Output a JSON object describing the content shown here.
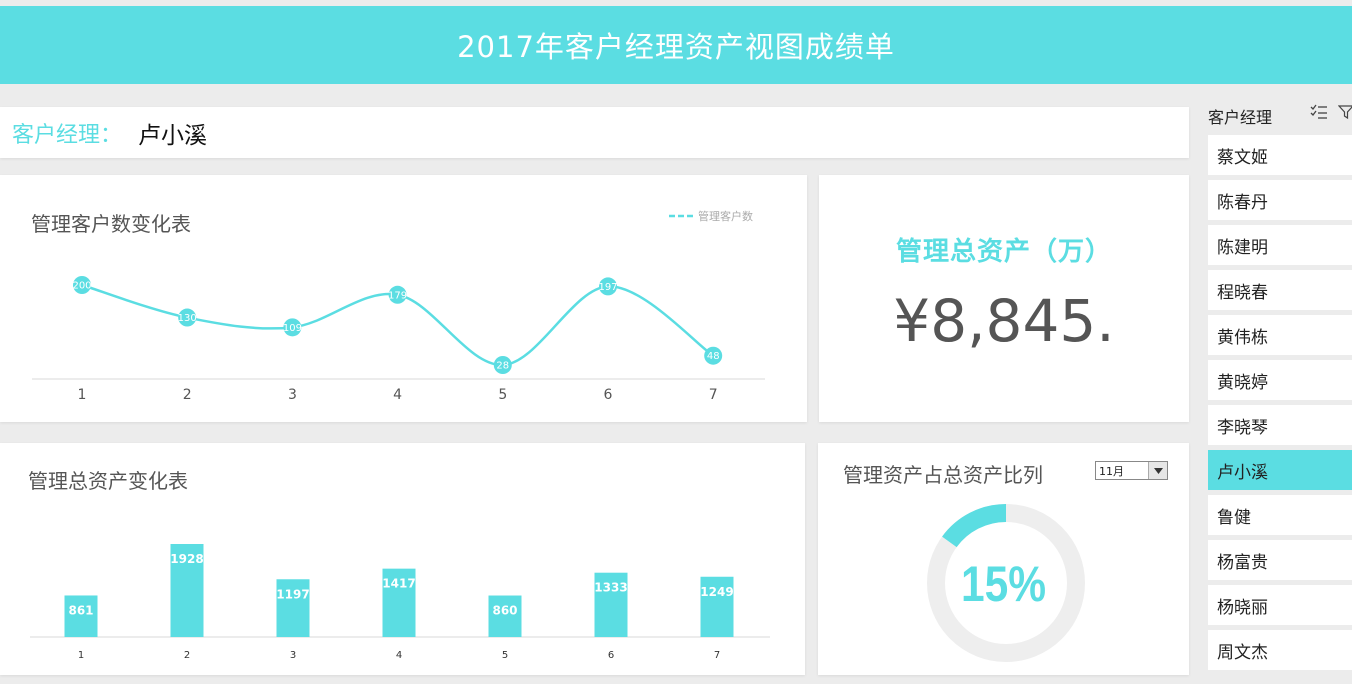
{
  "header": {
    "title": "2017年客户经理资产视图成绩单"
  },
  "manager": {
    "label": "客户经理：",
    "name": "卢小溪"
  },
  "customer_chart": {
    "title": "管理客户数变化表",
    "legend": "管理客户数"
  },
  "asset_card": {
    "title": "管理总资产（万）",
    "value": "¥8,845."
  },
  "asset_chart": {
    "title": "管理总资产变化表"
  },
  "ratio_card": {
    "title": "管理资产占总资产比列",
    "month": "11月",
    "percent_label": "15%",
    "percent": 15
  },
  "slicer": {
    "title": "客户经理",
    "items": [
      "蔡文姬",
      "陈春丹",
      "陈建明",
      "程晓春",
      "黄伟栋",
      "黄晓婷",
      "李晓琴",
      "卢小溪",
      "鲁健",
      "杨富贵",
      "杨晓丽",
      "周文杰"
    ],
    "selected": "卢小溪"
  },
  "colors": {
    "accent": "#5bdde2",
    "track": "#eeeeee"
  },
  "chart_data": [
    {
      "type": "line",
      "title": "管理客户数变化表",
      "categories": [
        "1",
        "2",
        "3",
        "4",
        "5",
        "6",
        "7"
      ],
      "series": [
        {
          "name": "管理客户数",
          "values": [
            200,
            130,
            109,
            179,
            28,
            197,
            48
          ]
        }
      ],
      "smooth": true,
      "legend": "top-right"
    },
    {
      "type": "bar",
      "title": "管理总资产变化表",
      "categories": [
        "1",
        "2",
        "3",
        "4",
        "5",
        "6",
        "7"
      ],
      "values": [
        861,
        1928,
        1197,
        1417,
        860,
        1333,
        1249
      ]
    }
  ]
}
